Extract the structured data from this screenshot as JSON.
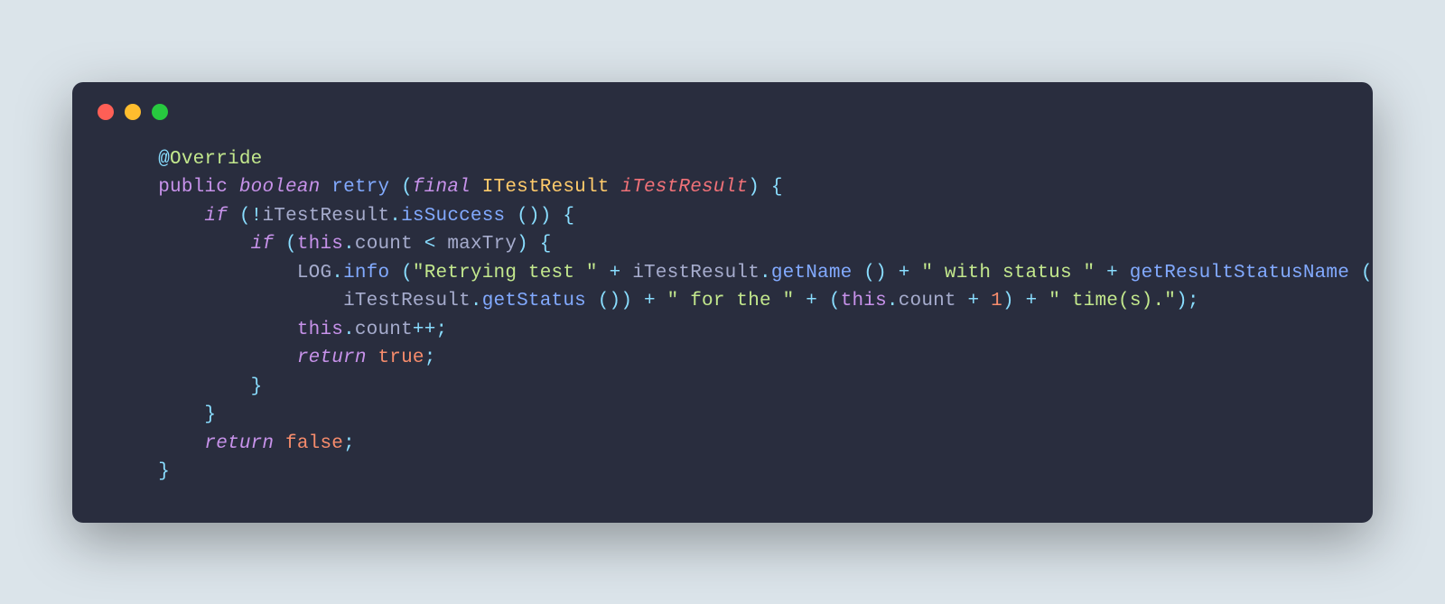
{
  "annot": {
    "at": "@",
    "name": "Override"
  },
  "kw": {
    "public": "public",
    "boolean": "boolean",
    "final": "final",
    "if": "if",
    "this": "this",
    "return": "return"
  },
  "fn": {
    "retry": "retry",
    "isSuccess": "isSuccess",
    "info": "info",
    "getName": "getName",
    "getResultStatusName": "getResultStatusName",
    "getStatus": "getStatus"
  },
  "type": {
    "ITestResult": "ITestResult"
  },
  "param": {
    "iTestResult": "iTestResult"
  },
  "ident": {
    "iTestResult": "iTestResult",
    "count": "count",
    "maxTry": "maxTry",
    "LOG": "LOG"
  },
  "str": {
    "s1": "\"Retrying test \"",
    "s2": "\" with status \"",
    "s3": "\" for the \"",
    "s4": "\" time(s).\""
  },
  "num": {
    "one": "1"
  },
  "bool": {
    "t": "true",
    "f": "false"
  },
  "punc": {
    "lp": "(",
    "rp": ")",
    "lb": "{",
    "rb": "}",
    "sc": ";",
    "dot": ".",
    "lt": "<",
    "bang": "!",
    "plus": "+",
    "pp": "++"
  },
  "ws": {
    "sp1": " ",
    "sp4": "    ",
    "sp8": "        ",
    "sp12": "            ",
    "sp16": "                "
  }
}
